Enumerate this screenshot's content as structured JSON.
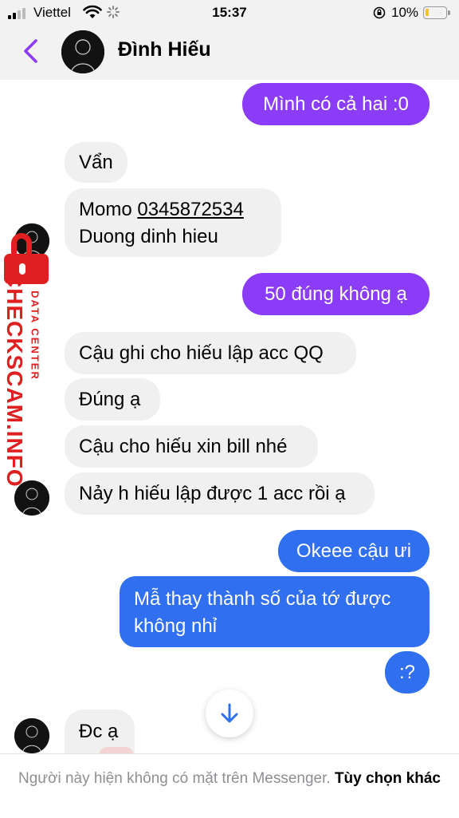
{
  "status_bar": {
    "carrier": "Viettel",
    "time": "15:37",
    "battery": "10%"
  },
  "header": {
    "contact_name": "Đình Hiếu"
  },
  "messages": [
    {
      "side": "out",
      "text": "Mình có cả hai :0"
    },
    {
      "side": "in",
      "text": "Vẩn"
    },
    {
      "side": "in",
      "line1_prefix": "Momo ",
      "line1_number": "0345872534",
      "line2": "Duong dinh hieu"
    },
    {
      "side": "out",
      "text": "50 đúng không ạ"
    },
    {
      "side": "in",
      "text": "Cậu ghi cho hiếu lập acc QQ"
    },
    {
      "side": "in",
      "text": "Đúng ạ"
    },
    {
      "side": "in",
      "text": "Cậu cho hiếu xin bill nhé"
    },
    {
      "side": "in",
      "text": "Nảy h hiếu lập được 1 acc rồi ạ"
    },
    {
      "side": "out",
      "text": "Okeee cậu ưi"
    },
    {
      "side": "out",
      "line1": "Mẫ thay thành số của tớ được",
      "line2": "không nhỉ"
    },
    {
      "side": "out",
      "text": ":?"
    },
    {
      "side": "in",
      "text": "Đc ạ"
    }
  ],
  "watermark": {
    "main": "CHECKSCAM.INFO",
    "sub": "DATA CENTER"
  },
  "footer": {
    "notice": "Người này hiện không có mặt trên Messenger.",
    "link": "Tùy chọn khác"
  },
  "colors": {
    "outgoing_purple": "#8b3cf6",
    "outgoing_blue": "#2f6ff0",
    "incoming": "#f0f0f0",
    "back_arrow": "#8b3cf6",
    "watermark": "#e02020"
  }
}
